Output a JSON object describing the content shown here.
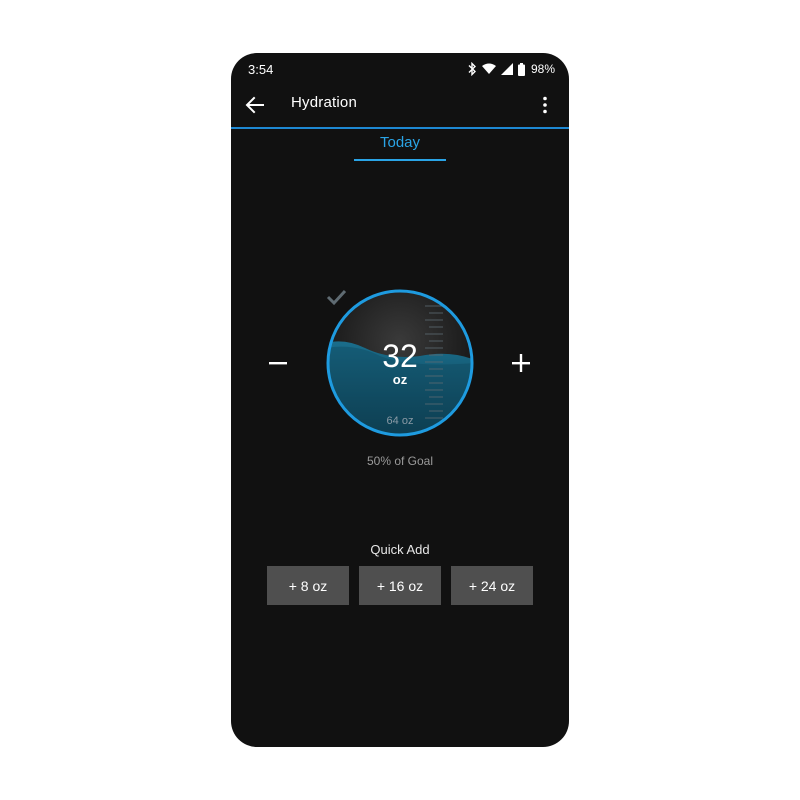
{
  "status_bar": {
    "time": "3:54",
    "battery": "98%"
  },
  "app_bar": {
    "title": "Hydration",
    "back_icon": "arrow-back-icon",
    "menu_icon": "more-vert-icon"
  },
  "tabs": [
    {
      "label": "Today",
      "selected": true
    }
  ],
  "gauge": {
    "value": "32",
    "unit": "oz",
    "goal": "64 oz",
    "fill_fraction": 0.5
  },
  "goal_percent_text": "50% of Goal",
  "quick_add": {
    "label": "Quick Add",
    "buttons": [
      "+ 8 oz",
      "+ 16 oz",
      "+ 24 oz"
    ]
  },
  "colors": {
    "accent": "#2aa4e6",
    "background": "#111111",
    "button": "#4f4f4f",
    "water": "#1a6e8c"
  }
}
